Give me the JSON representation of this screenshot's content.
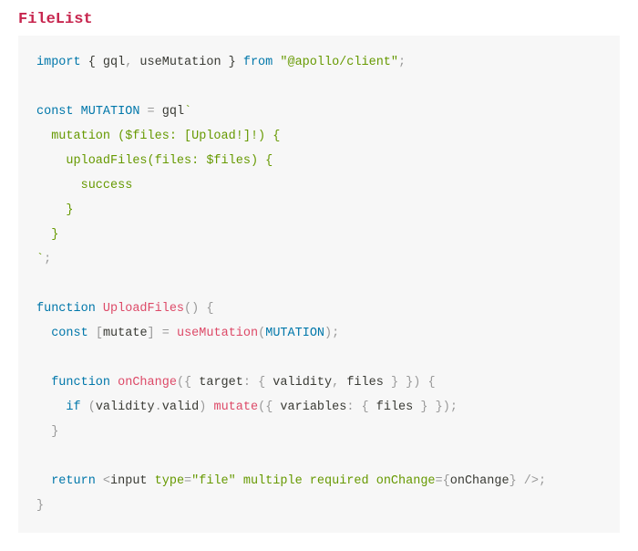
{
  "title": "FileList",
  "code": {
    "l1": {
      "a": "import",
      "b": " { gql",
      "c": ",",
      "d": " useMutation } ",
      "e": "from",
      "f": " ",
      "g": "\"@apollo/client\"",
      "h": ";"
    },
    "l3": {
      "a": "const",
      "b": " ",
      "c": "MUTATION",
      "d": " ",
      "e": "=",
      "f": " gql",
      "g": "`"
    },
    "l4": {
      "a": "  mutation ($files: [Upload!]!) {"
    },
    "l5": {
      "a": "    uploadFiles(files: $files) {"
    },
    "l6": {
      "a": "      success"
    },
    "l7": {
      "a": "    }"
    },
    "l8": {
      "a": "  }"
    },
    "l9": {
      "a": "`",
      "b": ";"
    },
    "l11": {
      "a": "function",
      "b": " ",
      "c": "UploadFiles",
      "d": "(",
      "e": ")",
      "f": " ",
      "g": "{"
    },
    "l12": {
      "a": "  ",
      "b": "const",
      "c": " ",
      "d": "[",
      "e": "mutate",
      "f": "]",
      "g": " ",
      "h": "=",
      "i": " ",
      "j": "useMutation",
      "k": "(",
      "l": "MUTATION",
      "m": ")",
      "n": ";"
    },
    "l14": {
      "a": "  ",
      "b": "function",
      "c": " ",
      "d": "onChange",
      "e": "(",
      "f": "{",
      "g": " target",
      "h": ":",
      "i": " ",
      "j": "{",
      "k": " validity",
      "l": ",",
      "m": " files ",
      "n": "}",
      "o": " ",
      "p": "}",
      "q": ")",
      "r": " ",
      "s": "{"
    },
    "l15": {
      "a": "    ",
      "b": "if",
      "c": " ",
      "d": "(",
      "e": "validity",
      "f": ".",
      "g": "valid",
      "h": ")",
      "i": " ",
      "j": "mutate",
      "k": "(",
      "l": "{",
      "m": " variables",
      "n": ":",
      "o": " ",
      "p": "{",
      "q": " files ",
      "r": "}",
      "s": " ",
      "t": "}",
      "u": ")",
      "v": ";"
    },
    "l16": {
      "a": "  ",
      "b": "}"
    },
    "l18": {
      "a": "  ",
      "b": "return",
      "c": " ",
      "d": "<",
      "e": "input ",
      "f": "type",
      "g": "=",
      "h": "\"file\"",
      "i": " ",
      "j": "multiple",
      "k": " ",
      "l": "required",
      "m": " ",
      "n": "onChange",
      "o": "=",
      "p": "{",
      "q": "onChange",
      "r": "}",
      "s": " ",
      "t": "/>",
      "u": ";"
    },
    "l19": {
      "a": "}"
    }
  }
}
